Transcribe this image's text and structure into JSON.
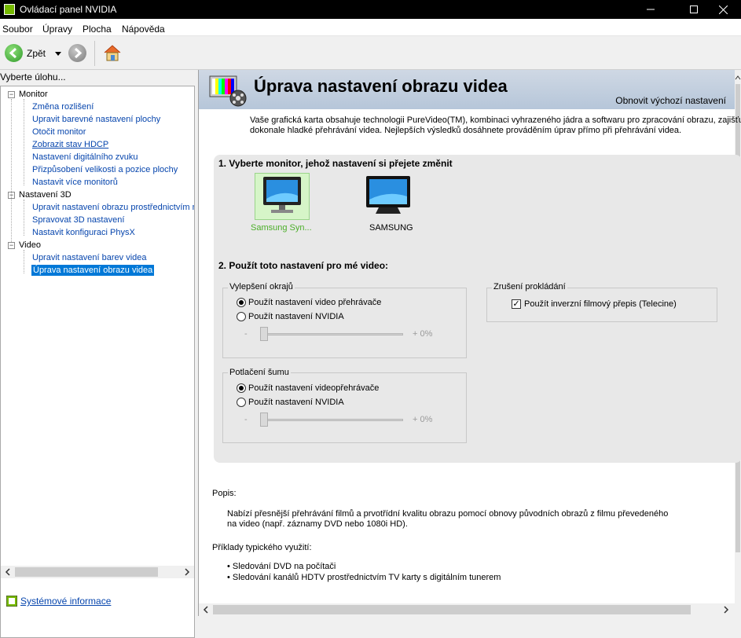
{
  "window": {
    "title": "Ovládací panel NVIDIA"
  },
  "menu": {
    "items": [
      "Soubor",
      "Úpravy",
      "Plocha",
      "Nápověda"
    ]
  },
  "toolbar": {
    "back_label": "Zpět"
  },
  "sidebar": {
    "header": "Vyberte úlohu...",
    "categories": [
      {
        "label": "Monitor",
        "items": [
          "Změna rozlišení",
          "Upravit barevné nastavení plochy",
          "Otočit monitor",
          "Zobrazit stav HDCP",
          "Nastavení digitálního zvuku",
          "Přizpůsobení velikosti a pozice plochy",
          "Nastavit více monitorů"
        ]
      },
      {
        "label": "Nastavení 3D",
        "items": [
          "Upravit nastavení obrazu prostřednictvím n",
          "Spravovat 3D nastavení",
          "Nastavit konfiguraci PhysX"
        ]
      },
      {
        "label": "Video",
        "items": [
          "Upravit nastavení barev videa",
          "Úprava nastavení obrazu videa"
        ]
      }
    ],
    "selected": "Úprava nastavení obrazu videa",
    "system_info": "Systémové informace"
  },
  "page": {
    "title": "Úprava nastavení obrazu videa",
    "restore_defaults": "Obnovit výchozí nastavení",
    "intro_line1": "Vaše grafická karta obsahuje technologii PureVideo(TM), kombinaci vyhrazeného jádra a softwaru pro zpracování obrazu, zajišťujíc",
    "intro_line2": "dokonale hladké přehrávání videa. Nejlepších výsledků dosáhnete prováděním úprav přímo při přehrávání videa.",
    "section1_title": "1. Vyberte monitor, jehož nastavení si přejete změnit",
    "monitors": [
      {
        "label": "Samsung Syn...",
        "selected": true
      },
      {
        "label": "SAMSUNG",
        "selected": false
      }
    ],
    "section2_title": "2. Použít toto nastavení pro mé video:",
    "edge": {
      "legend": "Vylepšení okrajů",
      "option1": "Použít nastavení video přehrávače",
      "option2": "Použít nastavení NVIDIA",
      "selected_option": 1,
      "slider_minus": "-",
      "slider_value": "+ 0%",
      "slider_level": 0
    },
    "noise": {
      "legend": "Potlačení šumu",
      "option1": "Použít nastavení videopřehrávače",
      "option2": "Použít nastavení NVIDIA",
      "selected_option": 1,
      "slider_minus": "-",
      "slider_value": "+ 0%",
      "slider_level": 0
    },
    "deinterlace": {
      "legend": "Zrušení prokládání",
      "checkbox_label": "Použít inverzní filmový přepis (Telecine)",
      "checked": true
    },
    "description_label": "Popis:",
    "description_line1": "Nabízí přesnější přehrávání filmů a prvotřídní kvalitu obrazu pomocí obnovy původních obrazů z filmu převedeného",
    "description_line2": "na video (např. záznamy DVD nebo 1080i HD).",
    "examples_label": "Příklady typického využití:",
    "examples": [
      "• Sledování DVD na počítači",
      "• Sledování kanálů HDTV prostřednictvím TV karty s digitálním tunerem"
    ]
  },
  "colors": {
    "nvidia_green": "#76b900",
    "selection_bg": "#0078d7",
    "link": "#0645ad"
  }
}
